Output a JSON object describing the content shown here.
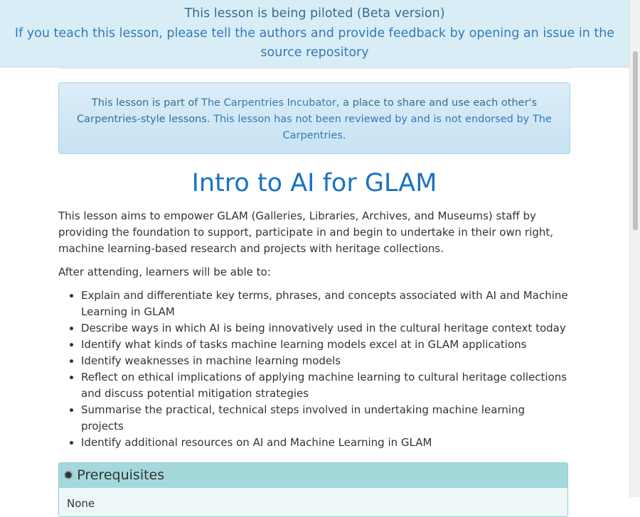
{
  "beta_banner": {
    "line1": "This lesson is being piloted (Beta version)",
    "line2": "If you teach this lesson, please tell the authors and provide feedback by opening an issue in the source repository"
  },
  "incubator": {
    "prefix": "This lesson is part of ",
    "link_text": "The Carpentries Incubator",
    "middle": ", a place to share and use each other's Carpentries-style lessons.",
    "note": " This lesson has not been reviewed by and is not endorsed by The Carpentries."
  },
  "title": "Intro to AI for GLAM",
  "intro": "This lesson aims to empower GLAM (Galleries, Libraries, Archives, and Museums) staff by providing the foundation to support, participate in and begin to undertake in their own right, machine learning-based research and projects with heritage collections.",
  "after_attending": "After attending, learners will be able to:",
  "objectives": [
    "Explain and differentiate key terms, phrases, and concepts associated with AI and Machine Learning in GLAM",
    "Describe ways in which AI is being innovatively used in the cultural heritage context today",
    "Identify what kinds of tasks machine learning models excel at in GLAM applications",
    "Identify weaknesses in machine learning models",
    "Reflect on ethical implications of applying machine learning to cultural heritage collections and discuss potential mitigation strategies",
    "Summarise the practical, technical steps involved in undertaking machine learning projects",
    "Identify additional resources on AI and Machine Learning in GLAM"
  ],
  "prerequisites": {
    "icon": "certificate-icon",
    "heading": "Prerequisites",
    "body": "None"
  },
  "colors": {
    "banner_bg": "#d9edf7",
    "banner_text": "#31708f",
    "link": "#337ab7",
    "title": "#1a72c0",
    "prereq_head": "#a4d8db",
    "prereq_body": "#eef7f8"
  }
}
